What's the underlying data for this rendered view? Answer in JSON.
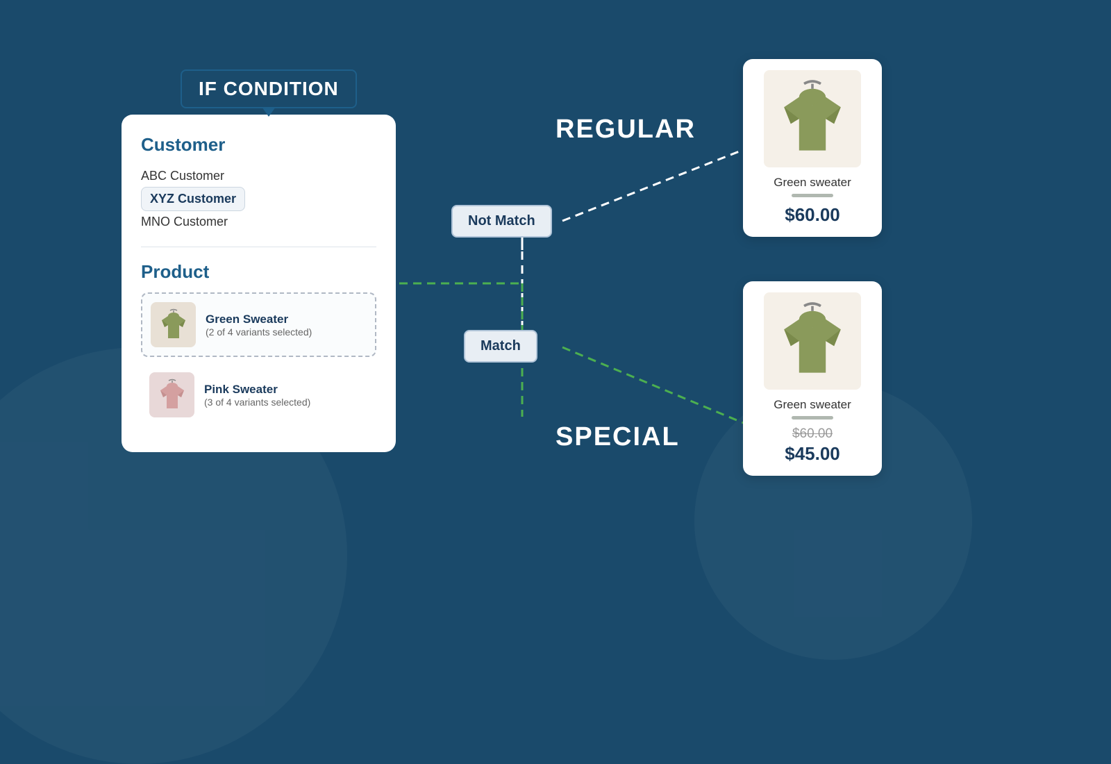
{
  "badge": {
    "label": "IF CONDITION"
  },
  "panel": {
    "customer_section": "Customer",
    "customers": [
      {
        "name": "ABC Customer",
        "selected": false
      },
      {
        "name": "XYZ Customer",
        "selected": true
      },
      {
        "name": "MNO Customer",
        "selected": false
      }
    ],
    "product_section": "Product",
    "products": [
      {
        "name": "Green Sweater",
        "variants": "(2 of 4 variants selected)",
        "color": "green",
        "selected": true
      },
      {
        "name": "Pink Sweater",
        "variants": "(3 of 4 variants selected)",
        "color": "pink",
        "selected": false
      }
    ]
  },
  "nodes": {
    "not_match": "Not Match",
    "match": "Match"
  },
  "routes": {
    "regular": "REGULAR",
    "special": "SPECIAL"
  },
  "cards": {
    "regular": {
      "name": "Green sweater",
      "price": "$60.00"
    },
    "special": {
      "name": "Green sweater",
      "price_original": "$60.00",
      "price_special": "$45.00"
    }
  }
}
